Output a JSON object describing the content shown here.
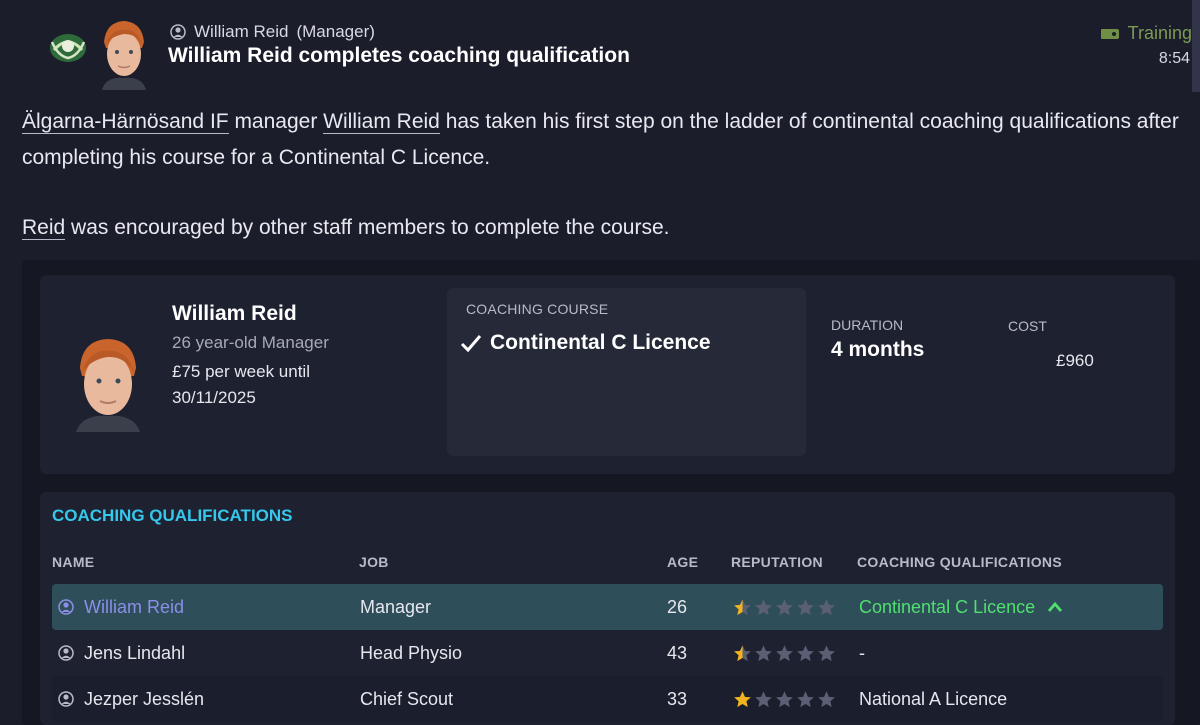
{
  "message": {
    "sender_name": "William Reid",
    "sender_role": "(Manager)",
    "title": "William Reid completes coaching qualification",
    "category": "Training",
    "time": "8:54"
  },
  "body": {
    "p1_club": "Älgarna-Härnösand IF",
    "p1_mid": " manager ",
    "p1_person": "William Reid",
    "p1_rest": " has taken his first step on the ladder of continental coaching qualifications after completing his course for a Continental C Licence.",
    "p2_person": "Reid",
    "p2_rest": " was encouraged by other staff members to complete the course."
  },
  "staff_card": {
    "name": "William Reid",
    "age_role": "26 year-old Manager",
    "wage": "£75 per week until 30/11/2025"
  },
  "course": {
    "label": "COACHING COURSE",
    "value": "Continental C Licence",
    "duration_label": "DURATION",
    "duration_value": "4 months",
    "cost_label": "COST",
    "cost_value": "£960"
  },
  "qualifications": {
    "title": "COACHING QUALIFICATIONS",
    "columns": [
      "NAME",
      "JOB",
      "AGE",
      "REPUTATION",
      "COACHING QUALIFICATIONS"
    ],
    "rows": [
      {
        "name": "William Reid",
        "job": "Manager",
        "age": "26",
        "reputation_stars": 0.5,
        "qualification": "Continental C Licence"
      },
      {
        "name": "Jens Lindahl",
        "job": "Head Physio",
        "age": "43",
        "reputation_stars": 0.5,
        "qualification": "-"
      },
      {
        "name": "Jezper Jesslén",
        "job": "Chief Scout",
        "age": "33",
        "reputation_stars": 1,
        "qualification": "National A Licence"
      }
    ]
  },
  "colors": {
    "accent_cyan": "#35c8ec",
    "qualification_green": "#4fe06d",
    "star_gold": "#f2b320",
    "star_empty": "#5b5f73",
    "category_green": "#7c9a52"
  }
}
